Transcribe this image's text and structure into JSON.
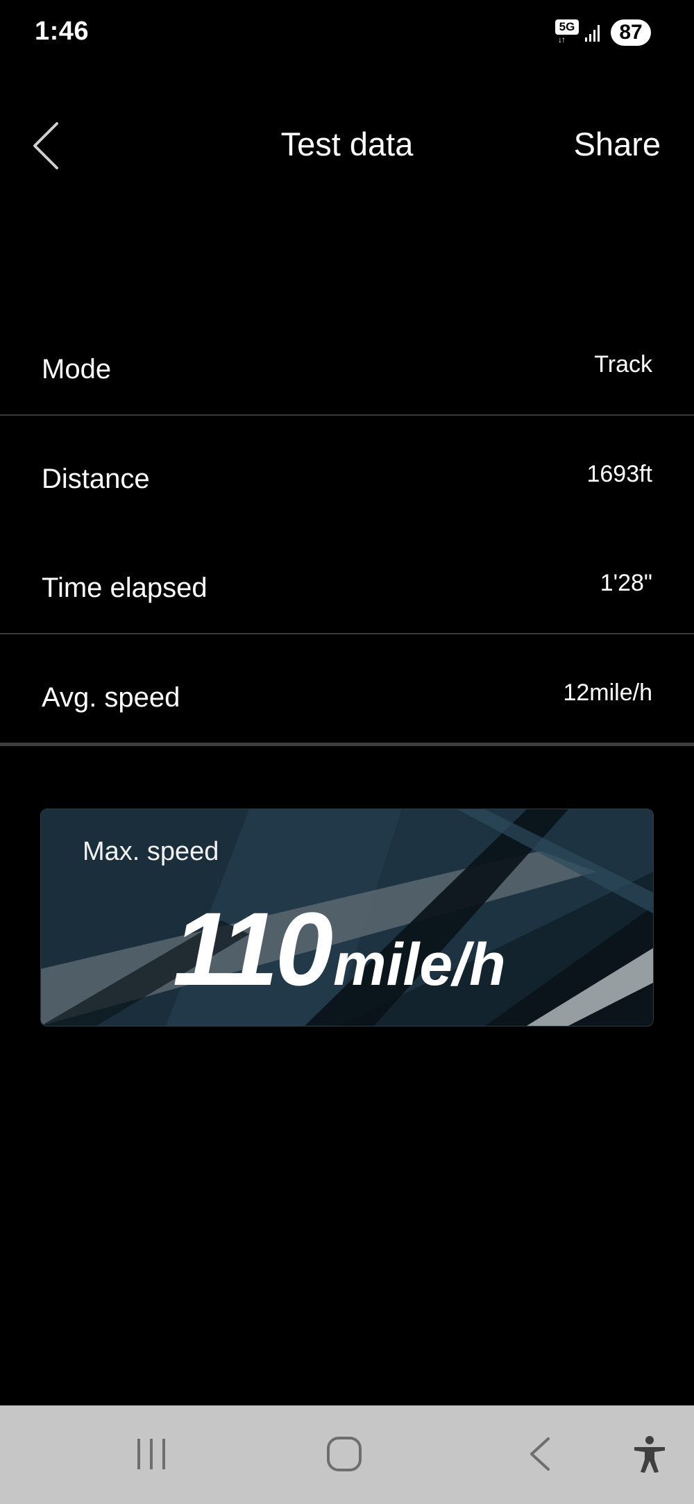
{
  "status_bar": {
    "time": "1:46",
    "network": "5G",
    "battery": "87"
  },
  "header": {
    "title": "Test data",
    "share_label": "Share"
  },
  "rows": [
    {
      "label": "Mode",
      "value": "Track"
    },
    {
      "label": "Distance",
      "value": "1693ft"
    },
    {
      "label": "Time elapsed",
      "value": "1'28\""
    },
    {
      "label": "Avg. speed",
      "value": "12mile/h"
    }
  ],
  "max_speed": {
    "label": "Max. speed",
    "value": "110",
    "unit": "mile/h"
  },
  "nav_bar": {
    "icons": [
      "recent-apps-icon",
      "home-icon",
      "back-icon",
      "accessibility-icon"
    ]
  },
  "colors": {
    "background": "#000000",
    "card_background": "#0f1e27",
    "nav_background": "#c6c6c6",
    "text": "#ffffff"
  }
}
